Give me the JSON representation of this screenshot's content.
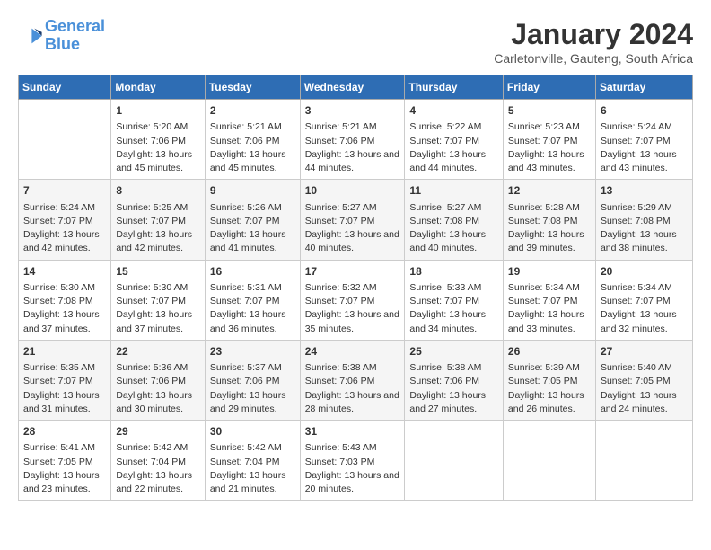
{
  "app": {
    "name": "GeneralBlue",
    "name_part1": "General",
    "name_part2": "Blue"
  },
  "calendar": {
    "month_year": "January 2024",
    "location": "Carletonville, Gauteng, South Africa",
    "days_of_week": [
      "Sunday",
      "Monday",
      "Tuesday",
      "Wednesday",
      "Thursday",
      "Friday",
      "Saturday"
    ],
    "weeks": [
      [
        {
          "day": "",
          "sunrise": "",
          "sunset": "",
          "daylight": ""
        },
        {
          "day": "1",
          "sunrise": "Sunrise: 5:20 AM",
          "sunset": "Sunset: 7:06 PM",
          "daylight": "Daylight: 13 hours and 45 minutes."
        },
        {
          "day": "2",
          "sunrise": "Sunrise: 5:21 AM",
          "sunset": "Sunset: 7:06 PM",
          "daylight": "Daylight: 13 hours and 45 minutes."
        },
        {
          "day": "3",
          "sunrise": "Sunrise: 5:21 AM",
          "sunset": "Sunset: 7:06 PM",
          "daylight": "Daylight: 13 hours and 44 minutes."
        },
        {
          "day": "4",
          "sunrise": "Sunrise: 5:22 AM",
          "sunset": "Sunset: 7:07 PM",
          "daylight": "Daylight: 13 hours and 44 minutes."
        },
        {
          "day": "5",
          "sunrise": "Sunrise: 5:23 AM",
          "sunset": "Sunset: 7:07 PM",
          "daylight": "Daylight: 13 hours and 43 minutes."
        },
        {
          "day": "6",
          "sunrise": "Sunrise: 5:24 AM",
          "sunset": "Sunset: 7:07 PM",
          "daylight": "Daylight: 13 hours and 43 minutes."
        }
      ],
      [
        {
          "day": "7",
          "sunrise": "Sunrise: 5:24 AM",
          "sunset": "Sunset: 7:07 PM",
          "daylight": "Daylight: 13 hours and 42 minutes."
        },
        {
          "day": "8",
          "sunrise": "Sunrise: 5:25 AM",
          "sunset": "Sunset: 7:07 PM",
          "daylight": "Daylight: 13 hours and 42 minutes."
        },
        {
          "day": "9",
          "sunrise": "Sunrise: 5:26 AM",
          "sunset": "Sunset: 7:07 PM",
          "daylight": "Daylight: 13 hours and 41 minutes."
        },
        {
          "day": "10",
          "sunrise": "Sunrise: 5:27 AM",
          "sunset": "Sunset: 7:07 PM",
          "daylight": "Daylight: 13 hours and 40 minutes."
        },
        {
          "day": "11",
          "sunrise": "Sunrise: 5:27 AM",
          "sunset": "Sunset: 7:08 PM",
          "daylight": "Daylight: 13 hours and 40 minutes."
        },
        {
          "day": "12",
          "sunrise": "Sunrise: 5:28 AM",
          "sunset": "Sunset: 7:08 PM",
          "daylight": "Daylight: 13 hours and 39 minutes."
        },
        {
          "day": "13",
          "sunrise": "Sunrise: 5:29 AM",
          "sunset": "Sunset: 7:08 PM",
          "daylight": "Daylight: 13 hours and 38 minutes."
        }
      ],
      [
        {
          "day": "14",
          "sunrise": "Sunrise: 5:30 AM",
          "sunset": "Sunset: 7:08 PM",
          "daylight": "Daylight: 13 hours and 37 minutes."
        },
        {
          "day": "15",
          "sunrise": "Sunrise: 5:30 AM",
          "sunset": "Sunset: 7:07 PM",
          "daylight": "Daylight: 13 hours and 37 minutes."
        },
        {
          "day": "16",
          "sunrise": "Sunrise: 5:31 AM",
          "sunset": "Sunset: 7:07 PM",
          "daylight": "Daylight: 13 hours and 36 minutes."
        },
        {
          "day": "17",
          "sunrise": "Sunrise: 5:32 AM",
          "sunset": "Sunset: 7:07 PM",
          "daylight": "Daylight: 13 hours and 35 minutes."
        },
        {
          "day": "18",
          "sunrise": "Sunrise: 5:33 AM",
          "sunset": "Sunset: 7:07 PM",
          "daylight": "Daylight: 13 hours and 34 minutes."
        },
        {
          "day": "19",
          "sunrise": "Sunrise: 5:34 AM",
          "sunset": "Sunset: 7:07 PM",
          "daylight": "Daylight: 13 hours and 33 minutes."
        },
        {
          "day": "20",
          "sunrise": "Sunrise: 5:34 AM",
          "sunset": "Sunset: 7:07 PM",
          "daylight": "Daylight: 13 hours and 32 minutes."
        }
      ],
      [
        {
          "day": "21",
          "sunrise": "Sunrise: 5:35 AM",
          "sunset": "Sunset: 7:07 PM",
          "daylight": "Daylight: 13 hours and 31 minutes."
        },
        {
          "day": "22",
          "sunrise": "Sunrise: 5:36 AM",
          "sunset": "Sunset: 7:06 PM",
          "daylight": "Daylight: 13 hours and 30 minutes."
        },
        {
          "day": "23",
          "sunrise": "Sunrise: 5:37 AM",
          "sunset": "Sunset: 7:06 PM",
          "daylight": "Daylight: 13 hours and 29 minutes."
        },
        {
          "day": "24",
          "sunrise": "Sunrise: 5:38 AM",
          "sunset": "Sunset: 7:06 PM",
          "daylight": "Daylight: 13 hours and 28 minutes."
        },
        {
          "day": "25",
          "sunrise": "Sunrise: 5:38 AM",
          "sunset": "Sunset: 7:06 PM",
          "daylight": "Daylight: 13 hours and 27 minutes."
        },
        {
          "day": "26",
          "sunrise": "Sunrise: 5:39 AM",
          "sunset": "Sunset: 7:05 PM",
          "daylight": "Daylight: 13 hours and 26 minutes."
        },
        {
          "day": "27",
          "sunrise": "Sunrise: 5:40 AM",
          "sunset": "Sunset: 7:05 PM",
          "daylight": "Daylight: 13 hours and 24 minutes."
        }
      ],
      [
        {
          "day": "28",
          "sunrise": "Sunrise: 5:41 AM",
          "sunset": "Sunset: 7:05 PM",
          "daylight": "Daylight: 13 hours and 23 minutes."
        },
        {
          "day": "29",
          "sunrise": "Sunrise: 5:42 AM",
          "sunset": "Sunset: 7:04 PM",
          "daylight": "Daylight: 13 hours and 22 minutes."
        },
        {
          "day": "30",
          "sunrise": "Sunrise: 5:42 AM",
          "sunset": "Sunset: 7:04 PM",
          "daylight": "Daylight: 13 hours and 21 minutes."
        },
        {
          "day": "31",
          "sunrise": "Sunrise: 5:43 AM",
          "sunset": "Sunset: 7:03 PM",
          "daylight": "Daylight: 13 hours and 20 minutes."
        },
        {
          "day": "",
          "sunrise": "",
          "sunset": "",
          "daylight": ""
        },
        {
          "day": "",
          "sunrise": "",
          "sunset": "",
          "daylight": ""
        },
        {
          "day": "",
          "sunrise": "",
          "sunset": "",
          "daylight": ""
        }
      ]
    ]
  }
}
